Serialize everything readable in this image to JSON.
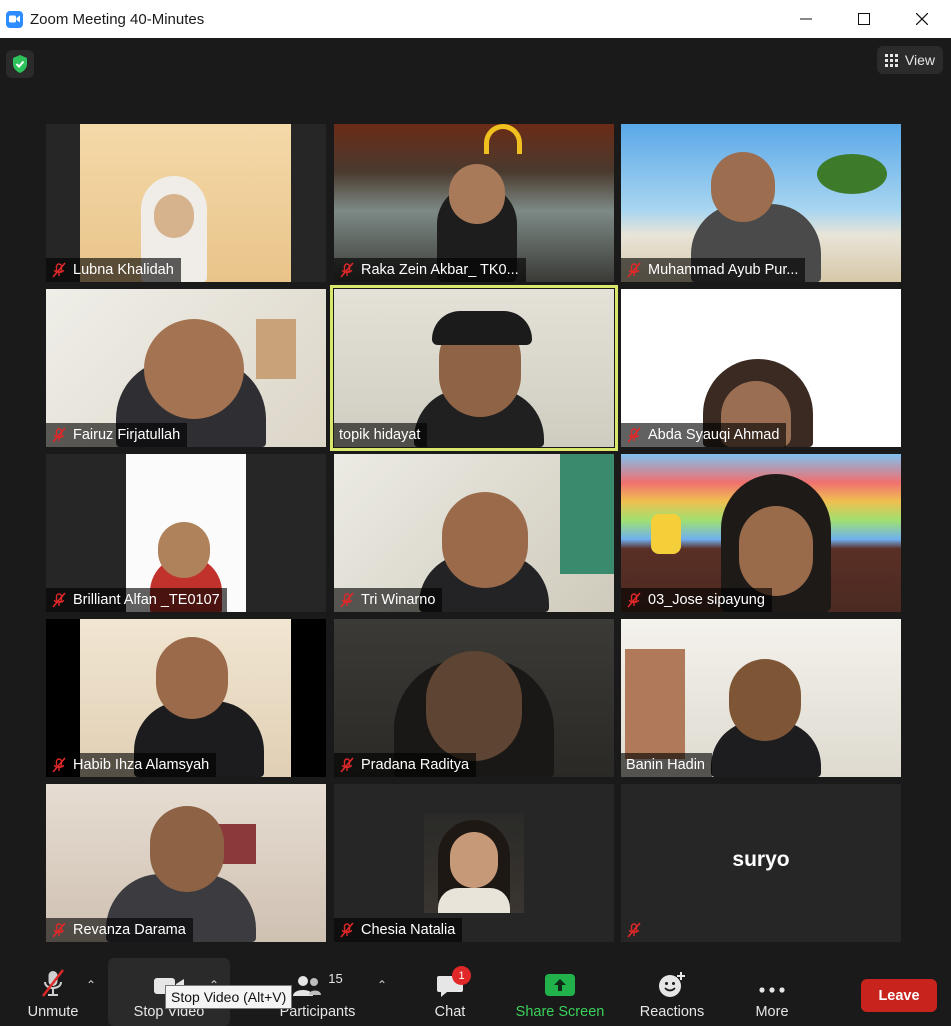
{
  "window": {
    "title": "Zoom Meeting 40-Minutes",
    "controls": [
      "minimize",
      "maximize",
      "close"
    ]
  },
  "meeting": {
    "security_icon": "shield-check-icon",
    "view_label": "View",
    "tiles": [
      {
        "name": "Lubna Khalidah",
        "muted": true,
        "speaking": false
      },
      {
        "name": "Raka Zein Akbar_ TK0...",
        "muted": true,
        "speaking": false
      },
      {
        "name": "Muhammad Ayub Pur...",
        "muted": true,
        "speaking": false
      },
      {
        "name": "Fairuz Firjatullah",
        "muted": true,
        "speaking": false
      },
      {
        "name": "topik hidayat",
        "muted": false,
        "speaking": true
      },
      {
        "name": "Abda Syauqi Ahmad",
        "muted": true,
        "speaking": false
      },
      {
        "name": "Brilliant Alfan _TE0107",
        "muted": true,
        "speaking": false
      },
      {
        "name": "Tri Winarno",
        "muted": true,
        "speaking": false
      },
      {
        "name": "03_Jose sipayung",
        "muted": true,
        "speaking": false
      },
      {
        "name": "Habib Ihza Alamsyah",
        "muted": true,
        "speaking": false
      },
      {
        "name": "Pradana Raditya",
        "muted": true,
        "speaking": false
      },
      {
        "name": "Banin Hadin",
        "muted": false,
        "speaking": false
      },
      {
        "name": "Revanza Darama",
        "muted": true,
        "speaking": false
      },
      {
        "name": "Chesia Natalia",
        "muted": true,
        "speaking": false
      },
      {
        "name": "",
        "big_name": "suryo",
        "muted": true,
        "speaking": false
      }
    ]
  },
  "toolbar": {
    "unmute": "Unmute",
    "stop_video": "Stop Video",
    "participants": "Participants",
    "participants_count": "15",
    "chat": "Chat",
    "chat_badge": "1",
    "share_screen": "Share Screen",
    "reactions": "Reactions",
    "more": "More",
    "leave": "Leave",
    "tooltip": "Stop Video (Alt+V)"
  },
  "colors": {
    "speaking_border": "#d9e86b",
    "leave_button": "#c8241d",
    "share_screen": "#3ad15a",
    "mute_red": "#e02828",
    "zoom_blue": "#2d8cff"
  }
}
